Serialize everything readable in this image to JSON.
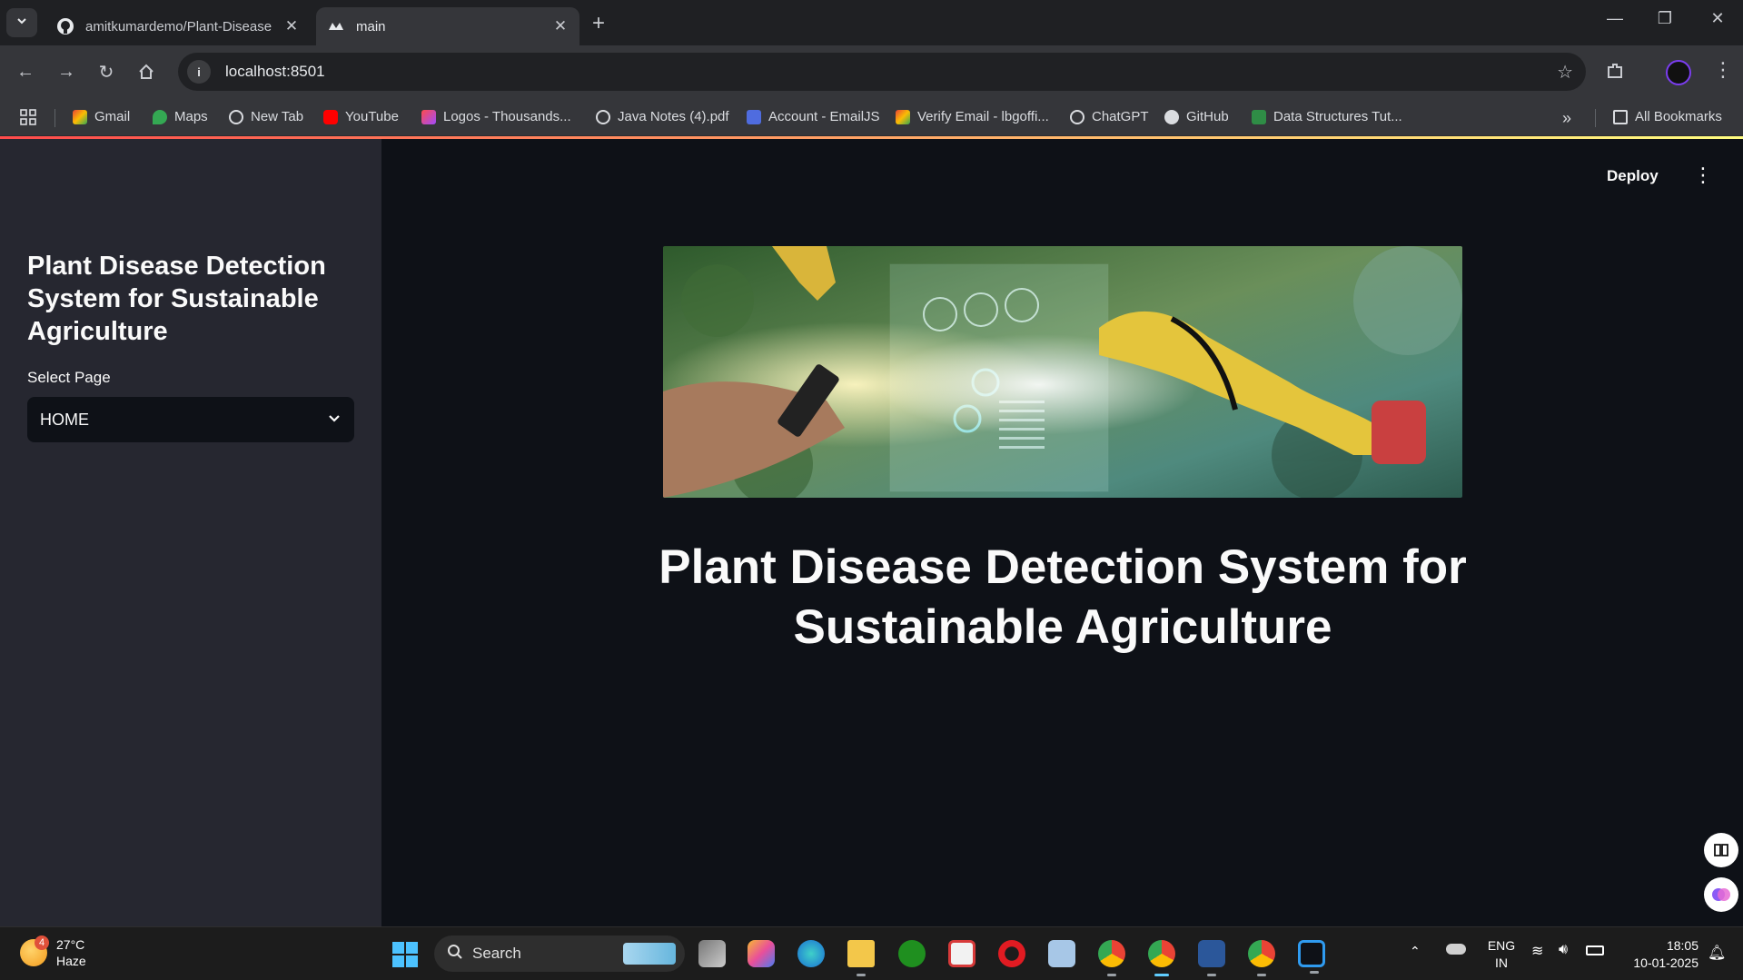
{
  "browser": {
    "tabs": [
      {
        "title": "amitkumardemo/Plant-Disease",
        "favicon": "github-icon",
        "active": false
      },
      {
        "title": "main",
        "favicon": "streamlit-icon",
        "active": true
      }
    ],
    "url": "localhost:8501",
    "bookmarks": [
      {
        "label": "Gmail",
        "icon": "gmail-icon"
      },
      {
        "label": "Maps",
        "icon": "maps-icon"
      },
      {
        "label": "New Tab",
        "icon": "globe-icon"
      },
      {
        "label": "YouTube",
        "icon": "youtube-icon"
      },
      {
        "label": "Logos - Thousands...",
        "icon": "logos-icon"
      },
      {
        "label": "Java Notes (4).pdf",
        "icon": "globe-icon"
      },
      {
        "label": "Account - EmailJS",
        "icon": "emailjs-icon"
      },
      {
        "label": "Verify Email - lbgoffi...",
        "icon": "gmail-icon"
      },
      {
        "label": "ChatGPT",
        "icon": "chatgpt-icon"
      },
      {
        "label": "GitHub",
        "icon": "github-icon"
      },
      {
        "label": "Data Structures Tut...",
        "icon": "gfg-icon"
      }
    ],
    "all_bookmarks_label": "All Bookmarks"
  },
  "app": {
    "sidebar": {
      "title": "Plant Disease Detection System for Sustainable Agriculture",
      "select_label": "Select Page",
      "select_value": "HOME"
    },
    "header": {
      "deploy_label": "Deploy"
    },
    "main": {
      "hero_image": "agriculture-robot-arm-plant-science-image",
      "title": "Plant Disease Detection System for Sustainable Agriculture"
    }
  },
  "taskbar": {
    "weather": {
      "temp": "27°C",
      "condition": "Haze",
      "badge": "4"
    },
    "search_placeholder": "Search",
    "language": {
      "line1": "ENG",
      "line2": "IN"
    },
    "clock": {
      "time": "18:05",
      "date": "10-01-2025"
    }
  },
  "colors": {
    "sidebar_bg": "#262730",
    "main_bg": "#0e1117",
    "accent_gradient_start": "#ff4b4b",
    "accent_gradient_end": "#fffd80"
  }
}
